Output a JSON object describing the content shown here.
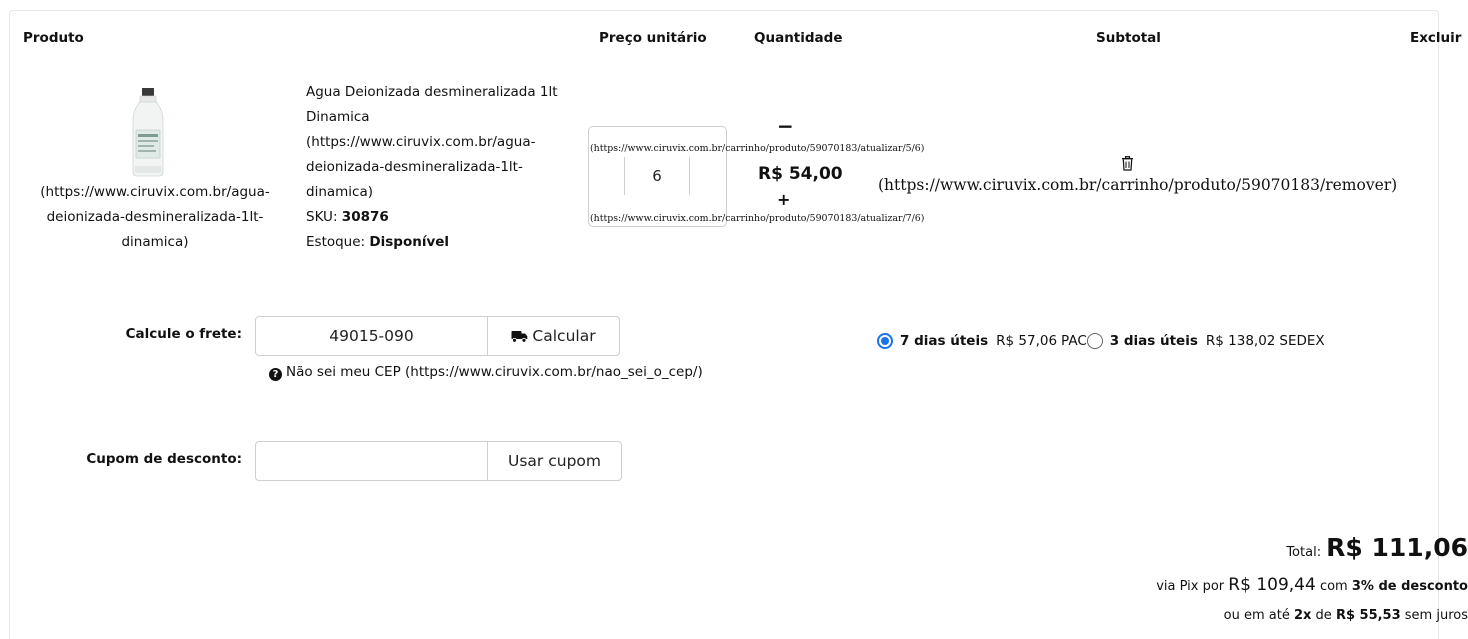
{
  "columns": {
    "product": "Produto",
    "unit_price": "Preço unitário",
    "quantity": "Quantidade",
    "subtotal": "Subtotal",
    "remove": "Excluir"
  },
  "item": {
    "image_link": "(https://www.ciruvix.com.br/agua-deionizada-desmineralizada-1lt-dinamica)",
    "name": "Agua Deionizada desmineralizada 1lt Dinamica",
    "name_link": "(https://www.ciruvix.com.br/agua-deionizada-desmineralizada-1lt-dinamica)",
    "sku_label": "SKU:",
    "sku": "30876",
    "stock_label": "Estoque:",
    "stock": "Disponível",
    "quantity": "6",
    "decrement_link": "(https://www.ciruvix.com.br/carrinho/produto/59070183/atualizar/5/6)",
    "increment_link": "(https://www.ciruvix.com.br/carrinho/produto/59070183/atualizar/7/6)",
    "minus": "−",
    "plus": "+",
    "subtotal": "R$ 54,00",
    "remove_link": "(https://www.ciruvix.com.br/carrinho/produto/59070183/remover)"
  },
  "shipping": {
    "label": "Calcule o frete:",
    "cep": "49015-090",
    "button": "Calcular",
    "help": "Não sei meu CEP (https://www.ciruvix.com.br/nao_sei_o_cep/)",
    "options": [
      {
        "days": "7 dias úteis",
        "price": "R$ 57,06",
        "service": "PAC",
        "selected": true
      },
      {
        "days": "3 dias úteis",
        "price": "R$ 138,02",
        "service": "SEDEX",
        "selected": false
      }
    ]
  },
  "coupon": {
    "label": "Cupom de desconto:",
    "value": "",
    "button": "Usar cupom"
  },
  "totals": {
    "total_label": "Total:",
    "total": "R$ 111,06",
    "pix_prefix": "via Pix por",
    "pix_value": "R$ 109,44",
    "pix_with": "com",
    "pix_discount": "3% de desconto",
    "inst_prefix": "ou em até",
    "inst_count": "2x",
    "inst_de": "de",
    "inst_value": "R$ 55,53",
    "inst_suffix": "sem juros"
  },
  "icons": {
    "truck": "truck-icon",
    "trash": "trash-icon",
    "help": "question-circle-icon"
  },
  "colors": {
    "radio_selected": "#1a73e8",
    "border": "#cfcfcf"
  }
}
